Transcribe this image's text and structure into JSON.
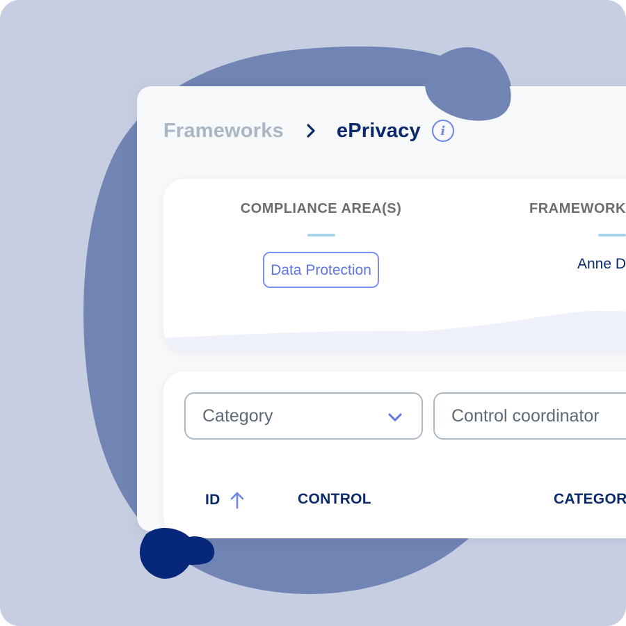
{
  "breadcrumb": {
    "parent": "Frameworks",
    "current": "ePrivacy",
    "separator_icon": "chevron-right-icon",
    "info_icon": "info-icon",
    "info_glyph": "i"
  },
  "summary": {
    "compliance_area": {
      "title": "COMPLIANCE AREA(S)",
      "tag": "Data Protection"
    },
    "framework_owner": {
      "title": "FRAMEWORK",
      "value": "Anne D"
    }
  },
  "filters": {
    "category": {
      "placeholder": "Category",
      "icon": "chevron-down-icon"
    },
    "coordinator": {
      "placeholder": "Control coordinator"
    }
  },
  "table": {
    "columns": [
      "ID",
      "CONTROL",
      "CATEGOR"
    ],
    "sort_icon": "arrow-up-icon",
    "sorted_column": "ID"
  },
  "colors": {
    "background": "#c8cee2",
    "blob": "#7185b5",
    "blob_dark": "#06277a",
    "heading": "#0b2a6b",
    "accent": "#6f86e8",
    "muted": "#a9b6c4"
  }
}
